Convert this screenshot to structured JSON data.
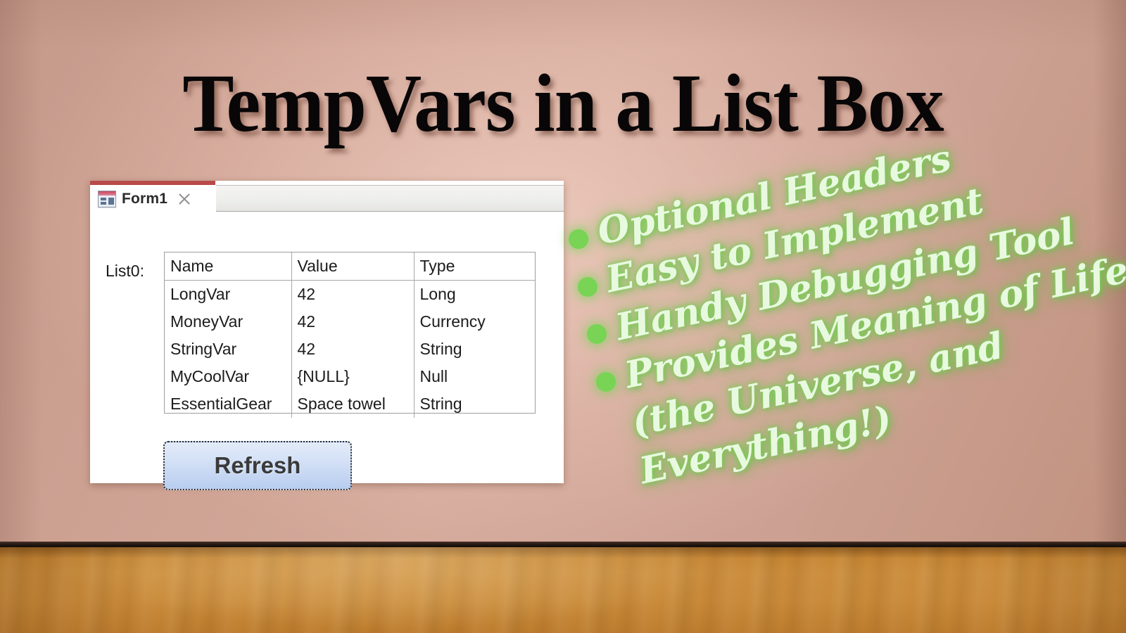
{
  "slide": {
    "title": "TempVars in a List Box",
    "background_wall_color": "#cda192",
    "floor_color": "#c98a39"
  },
  "access_window": {
    "accent_color": "#b94a4a",
    "tab": {
      "label": "Form1",
      "icon": "form-view-icon",
      "close_icon": "close-icon"
    },
    "list_label": "List0:",
    "listbox": {
      "headers": [
        "Name",
        "Value",
        "Type"
      ],
      "rows": [
        {
          "name": "LongVar",
          "value": "42",
          "type": "Long"
        },
        {
          "name": "MoneyVar",
          "value": "42",
          "type": "Currency"
        },
        {
          "name": "StringVar",
          "value": "42",
          "type": "String"
        },
        {
          "name": "MyCoolVar",
          "value": "{NULL}",
          "type": "Null"
        },
        {
          "name": "EssentialGear",
          "value": "Space towel",
          "type": "String"
        }
      ]
    },
    "refresh_button": {
      "label": "Refresh",
      "focused": true
    }
  },
  "bullet_list": {
    "bullet_color": "#79d455",
    "text_color": "#e9f9e0",
    "items": [
      {
        "lines": [
          "Optional Headers"
        ]
      },
      {
        "lines": [
          "Easy to Implement"
        ]
      },
      {
        "lines": [
          "Handy Debugging Tool"
        ]
      },
      {
        "lines": [
          "Provides Meaning of Life",
          "(the Universe, and",
          "Everything!)"
        ]
      }
    ]
  }
}
